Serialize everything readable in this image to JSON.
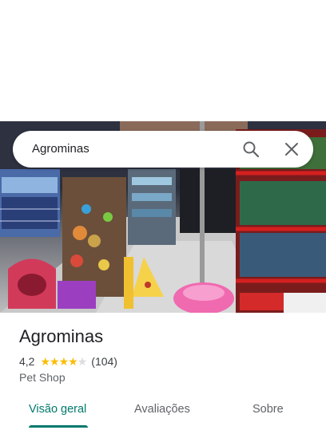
{
  "search": {
    "query": "Agrominas"
  },
  "place": {
    "name": "Agrominas",
    "rating": "4,2",
    "stars_filled": 4,
    "stars_total": 5,
    "review_count": "(104)",
    "category": "Pet Shop"
  },
  "tabs": [
    {
      "label": "Visão geral",
      "active": true
    },
    {
      "label": "Avaliações",
      "active": false
    },
    {
      "label": "Sobre",
      "active": false
    }
  ],
  "colors": {
    "star_filled": "#fbbc04",
    "star_empty": "#dadce0",
    "accent": "#00796b"
  },
  "icons": [
    "search-icon",
    "close-icon"
  ]
}
